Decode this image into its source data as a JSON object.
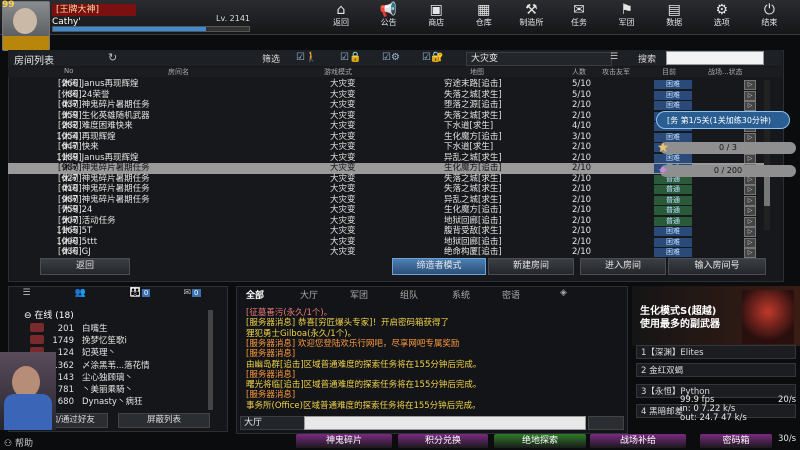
{
  "player": {
    "level_badge": "99",
    "avatar_tag": "",
    "guild": "[王牌大神]",
    "name": "Cathy'",
    "lv": "Lv. 2141",
    "xp_fraction": 0.78
  },
  "nav": [
    {
      "id": "back",
      "label": "返回",
      "icon": "⌂"
    },
    {
      "id": "notice",
      "label": "公告",
      "icon": "📢"
    },
    {
      "id": "shop",
      "label": "商店",
      "icon": "▣"
    },
    {
      "id": "storage",
      "label": "仓库",
      "icon": "▦"
    },
    {
      "id": "workshop",
      "label": "制造所",
      "icon": "⚒"
    },
    {
      "id": "mission",
      "label": "任务",
      "icon": "✉"
    },
    {
      "id": "clan",
      "label": "军团",
      "icon": "⚑"
    },
    {
      "id": "data",
      "label": "数据",
      "icon": "▤"
    },
    {
      "id": "options",
      "label": "选项",
      "icon": "⚙"
    },
    {
      "id": "quit",
      "label": "结束",
      "icon": "⏻"
    }
  ],
  "room_list": {
    "title": "房间列表",
    "filter_label": "筛选",
    "mode_selected": "大灾变",
    "search_label": "搜索",
    "search_value": "",
    "columns": {
      "no": "No",
      "name": "房间名",
      "mode": "游戏模式",
      "map": "地图",
      "count": "人数",
      "attack": "攻击友军",
      "state": "目前",
      "extra": "战场...状态"
    },
    "rows": [
      {
        "no": "266",
        "name": "[休闲]Janus再现辉煌",
        "mode": "大灾变",
        "map": "穷途末路[追击]",
        "count": "5/10",
        "state": "困难"
      },
      {
        "no": "86",
        "name": "[休闲]24荣誉",
        "mode": "大灾变",
        "map": "失落之城[求生]",
        "count": "5/10",
        "state": "困难"
      },
      {
        "no": "437",
        "name": "[休闲]神鬼碎片暑期任务",
        "mode": "大灾变",
        "map": "堕落之源[追击]",
        "count": "2/10",
        "state": "困难"
      },
      {
        "no": "359",
        "name": "[休闲]生化英雄随机武器",
        "mode": "大灾变",
        "map": "失落之城[求生]",
        "count": "2/10",
        "state": "困难"
      },
      {
        "no": "282",
        "name": "[休闲]难度困难快来",
        "mode": "大灾变",
        "map": "下水道[求生]",
        "count": "4/10",
        "state": "困难"
      },
      {
        "no": "1054",
        "name": "[休闲]再现辉煌",
        "mode": "大灾变",
        "map": "生化魔方[追击]",
        "count": "3/10",
        "state": "困难"
      },
      {
        "no": "647",
        "name": "[休闲]快来",
        "mode": "大灾变",
        "map": "下水道[求生]",
        "count": "2/10",
        "state": "困难"
      },
      {
        "no": "1189",
        "name": "[休闲]Janus再现辉煌",
        "mode": "大灾变",
        "map": "异乱之城[求生]",
        "count": "2/10",
        "state": "困难"
      },
      {
        "no": "987",
        "name": "[休闲]神鬼碎片暑期任务",
        "mode": "大灾变",
        "map": "生化魔方[追击]",
        "count": "2/10",
        "state": "困难"
      },
      {
        "no": "627",
        "name": "[休闲]神鬼碎片暑期任务",
        "mode": "大灾变",
        "map": "失落之城[求生]",
        "count": "2/10",
        "state": "普通"
      },
      {
        "no": "418",
        "name": "[休闲]神鬼碎片暑期任务",
        "mode": "大灾变",
        "map": "失落之城[求生]",
        "count": "2/10",
        "state": "普通"
      },
      {
        "no": "987",
        "name": "[休闲]神鬼碎片暑期任务",
        "mode": "大灾变",
        "map": "异乱之城[求生]",
        "count": "2/10",
        "state": "普通"
      },
      {
        "no": "759",
        "name": "[休闲]24",
        "mode": "大灾变",
        "map": "生化魔方[追击]",
        "count": "2/10",
        "state": "普通"
      },
      {
        "no": "507",
        "name": "[休闲]活动任务",
        "mode": "大灾变",
        "map": "地狱回廊[追击]",
        "count": "2/10",
        "state": "普通"
      },
      {
        "no": "1165",
        "name": "[休闲]5T",
        "mode": "大灾变",
        "map": "腹背受敌[求生]",
        "count": "2/10",
        "state": "困难"
      },
      {
        "no": "1090",
        "name": "[休闲]5ttt",
        "mode": "大灾变",
        "map": "地狱回廊[追击]",
        "count": "2/10",
        "state": "困难"
      },
      {
        "no": "636",
        "name": "[休闲]GJ",
        "mode": "大灾变",
        "map": "绝命构厦[追击]",
        "count": "2/10",
        "state": "困难"
      }
    ],
    "selected_index": 8,
    "buttons": {
      "back": "返回",
      "spectate": "缔造者模式",
      "create": "新建房间",
      "join": "进入房间",
      "join_by_no": "输入房间号"
    }
  },
  "mission_popup": {
    "pill": "[务 第1/5关(1关加练30分钟)",
    "progress1": "0 / 3",
    "progress2": "0 / 200"
  },
  "friends": {
    "tab_badges": [
      "",
      "",
      "0",
      "0"
    ],
    "online_label": "在线 (18)",
    "list": [
      {
        "lv": "201",
        "name": "白嘴生"
      },
      {
        "lv": "1749",
        "name": "挽梦忆笙歌i"
      },
      {
        "lv": "124",
        "name": "妃英理丶"
      },
      {
        "lv": "1362",
        "name": "〆涂黑苇...落花情"
      },
      {
        "lv": "143",
        "name": "尘心独顾璃丶"
      },
      {
        "lv": "781",
        "name": "丶美丽乘騎丶"
      },
      {
        "lv": "680",
        "name": "Dynasty丶病狂"
      }
    ],
    "add_btn": "添加/通过好友",
    "block_btn": "屏蔽列表",
    "help": "帮助"
  },
  "chat": {
    "tabs": [
      "全部",
      "大厅",
      "军团",
      "组队",
      "系统",
      "密语"
    ],
    "active_tab": 0,
    "lines": [
      {
        "cls": "c-pnk",
        "text": "[征墓善污(永久/1个)。"
      },
      {
        "cls": "c-ylw",
        "text": "[服务器消息] 恭喜[穷匠爆头专家]！开启密码箱获得了"
      },
      {
        "cls": "c-ylw",
        "text": "狸犯勇士Gilboa(永久/1个)。"
      },
      {
        "cls": "c-org",
        "text": "[服务器消息] 欢迎您登陆欢乐行网吧，尽享网吧专属奖励"
      },
      {
        "cls": "c-org",
        "text": "[服务器消息]"
      },
      {
        "cls": "c-ylw",
        "text": "由幽岛群[追击]区域普通难度的探索任务将在155分钟后完成。"
      },
      {
        "cls": "c-org",
        "text": "[服务器消息]"
      },
      {
        "cls": "c-ylw",
        "text": "曙光将临[追击]区域普通难度的探索任务将在155分钟后完成。"
      },
      {
        "cls": "c-org",
        "text": "[服务器消息]"
      },
      {
        "cls": "c-ylw",
        "text": "事务所(Office)区域普通难度的探索任务将在155分钟后完成。"
      }
    ],
    "channel": "大厅",
    "input_value": ""
  },
  "promo": {
    "title": "生化模式S(超越)",
    "subtitle": "使用最多的副武器",
    "items": [
      "1【深渊】Elites",
      "2 金红双蝎",
      "3【永恒】Python",
      "4 黑暗邮差"
    ]
  },
  "stats": {
    "fps": "99.9 fps",
    "in": "in: 0 7.22 k/s",
    "out": "out: 24.7 47 k/s",
    "s1": "20/s",
    "s2": "30/s"
  },
  "bottom_bar": [
    {
      "label": "神鬼碎片",
      "color": "#7a2a82"
    },
    {
      "label": "积分兑换",
      "color": "#7a2a82"
    },
    {
      "label": "绝地探索",
      "color": "#2f7a2a"
    },
    {
      "label": "战场补给",
      "color": "#7a2a82"
    },
    {
      "label": "密码箱",
      "color": "#7a2a82"
    }
  ]
}
